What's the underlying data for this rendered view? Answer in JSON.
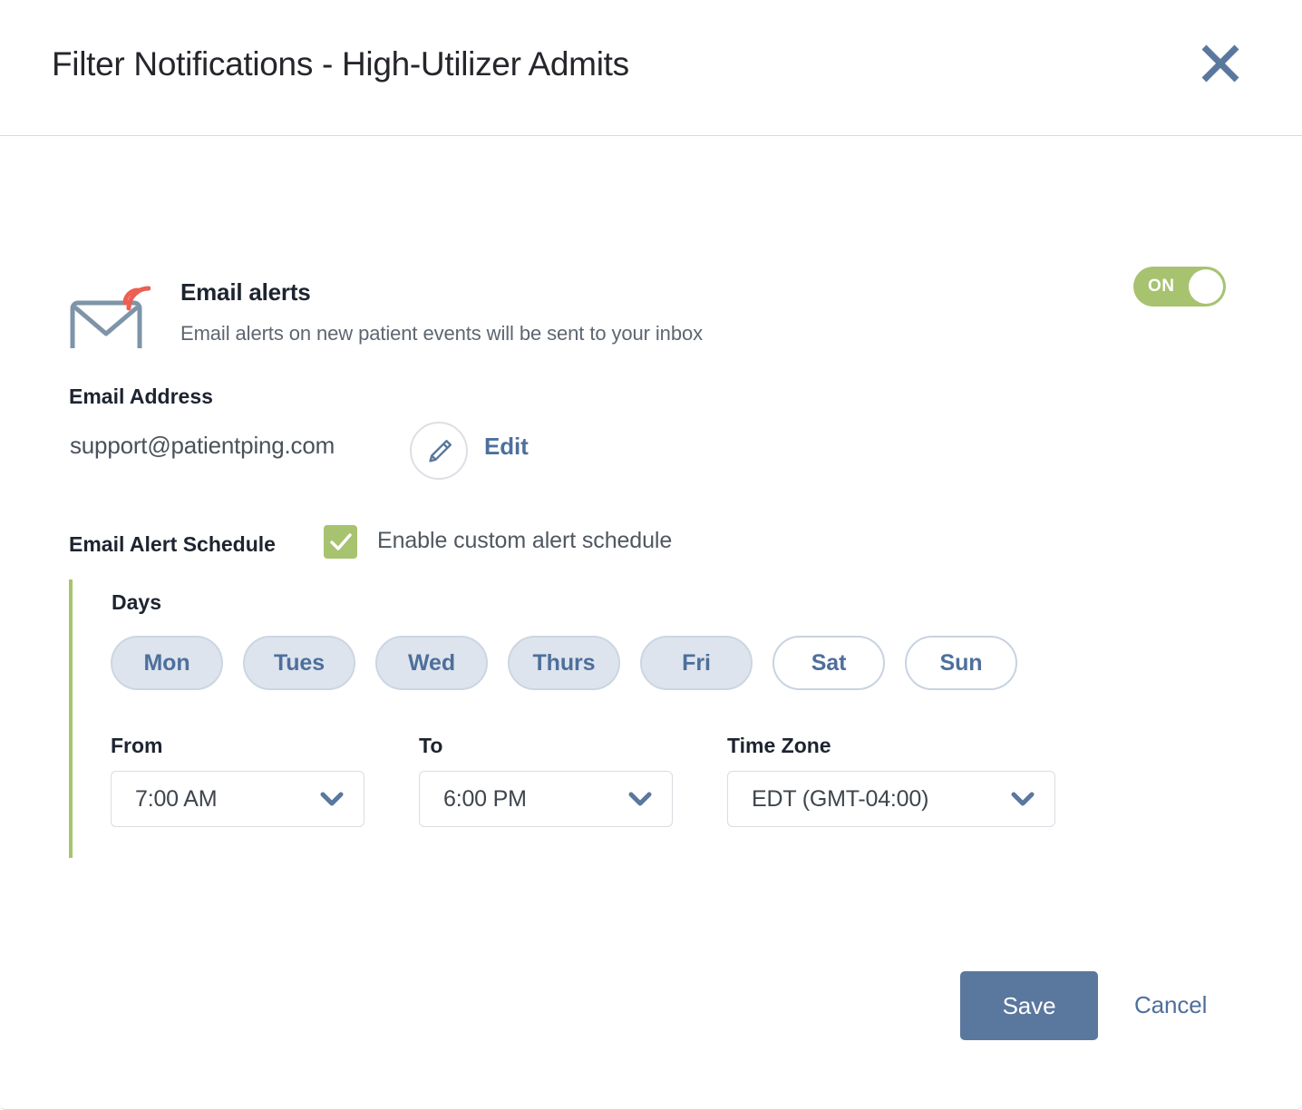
{
  "header": {
    "title": "Filter Notifications - High-Utilizer Admits",
    "close_icon": "close-icon"
  },
  "email_alerts": {
    "icon": "envelope-alert-icon",
    "title": "Email alerts",
    "description": "Email alerts on new patient events will be sent to your inbox",
    "toggle": {
      "label": "ON",
      "state": "on",
      "color": "#a7c36f"
    }
  },
  "email_address": {
    "label": "Email Address",
    "value": "support@patientping.com",
    "edit_icon": "pencil-icon",
    "edit_label": "Edit"
  },
  "schedule": {
    "label": "Email Alert Schedule",
    "checkbox_checked": true,
    "checkbox_label": "Enable custom alert schedule",
    "accent_color": "#a7c36f",
    "days_label": "Days",
    "days": [
      {
        "label": "Mon",
        "selected": true
      },
      {
        "label": "Tues",
        "selected": true
      },
      {
        "label": "Wed",
        "selected": true
      },
      {
        "label": "Thurs",
        "selected": true
      },
      {
        "label": "Fri",
        "selected": true
      },
      {
        "label": "Sat",
        "selected": false
      },
      {
        "label": "Sun",
        "selected": false
      }
    ],
    "from": {
      "label": "From",
      "value": "7:00 AM"
    },
    "to": {
      "label": "To",
      "value": "6:00 PM"
    },
    "timezone": {
      "label": "Time Zone",
      "value": "EDT (GMT-04:00)"
    }
  },
  "footer": {
    "save_label": "Save",
    "cancel_label": "Cancel",
    "save_color": "#5a779e"
  }
}
